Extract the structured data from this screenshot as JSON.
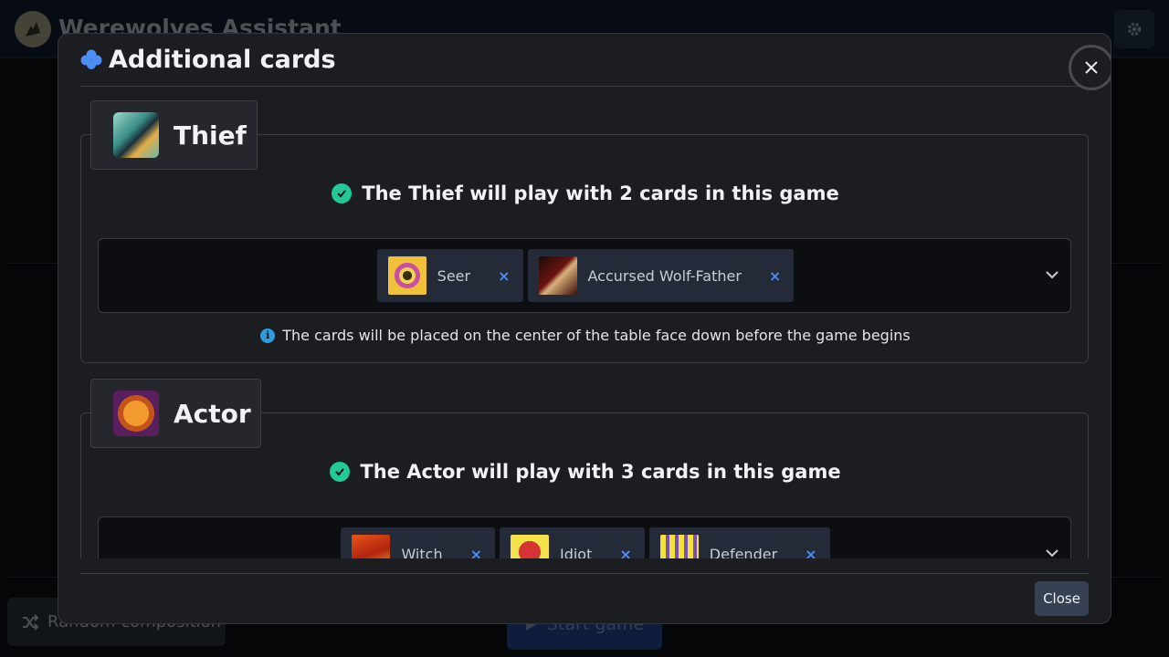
{
  "app": {
    "title": "Werewolves Assistant",
    "random_label": "Random composition",
    "start_label": "Start game"
  },
  "modal": {
    "title": "Additional cards",
    "close_label": "Close"
  },
  "sections": [
    {
      "role": "Thief",
      "status": "The Thief will play with 2 cards in this game",
      "cards": [
        {
          "label": "Seer",
          "remove": "×"
        },
        {
          "label": "Accursed Wolf-Father",
          "remove": "×"
        }
      ],
      "info": "The cards will be placed on the center of the table face down before the game begins"
    },
    {
      "role": "Actor",
      "status": "The Actor will play with 3 cards in this game",
      "cards": [
        {
          "label": "Witch",
          "remove": "×"
        },
        {
          "label": "Idiot",
          "remove": "×"
        },
        {
          "label": "Defender",
          "remove": "×"
        }
      ]
    }
  ],
  "colors": {
    "accent_blue": "#4d8df6",
    "success_green": "#20c997",
    "info_blue": "#2d9cdb"
  },
  "icons": [
    "wolf-logo-icon",
    "gear-icon",
    "clover-icon",
    "close-icon",
    "check-circle-icon",
    "info-icon",
    "chevron-down-icon",
    "shuffle-icon",
    "play-icon"
  ]
}
